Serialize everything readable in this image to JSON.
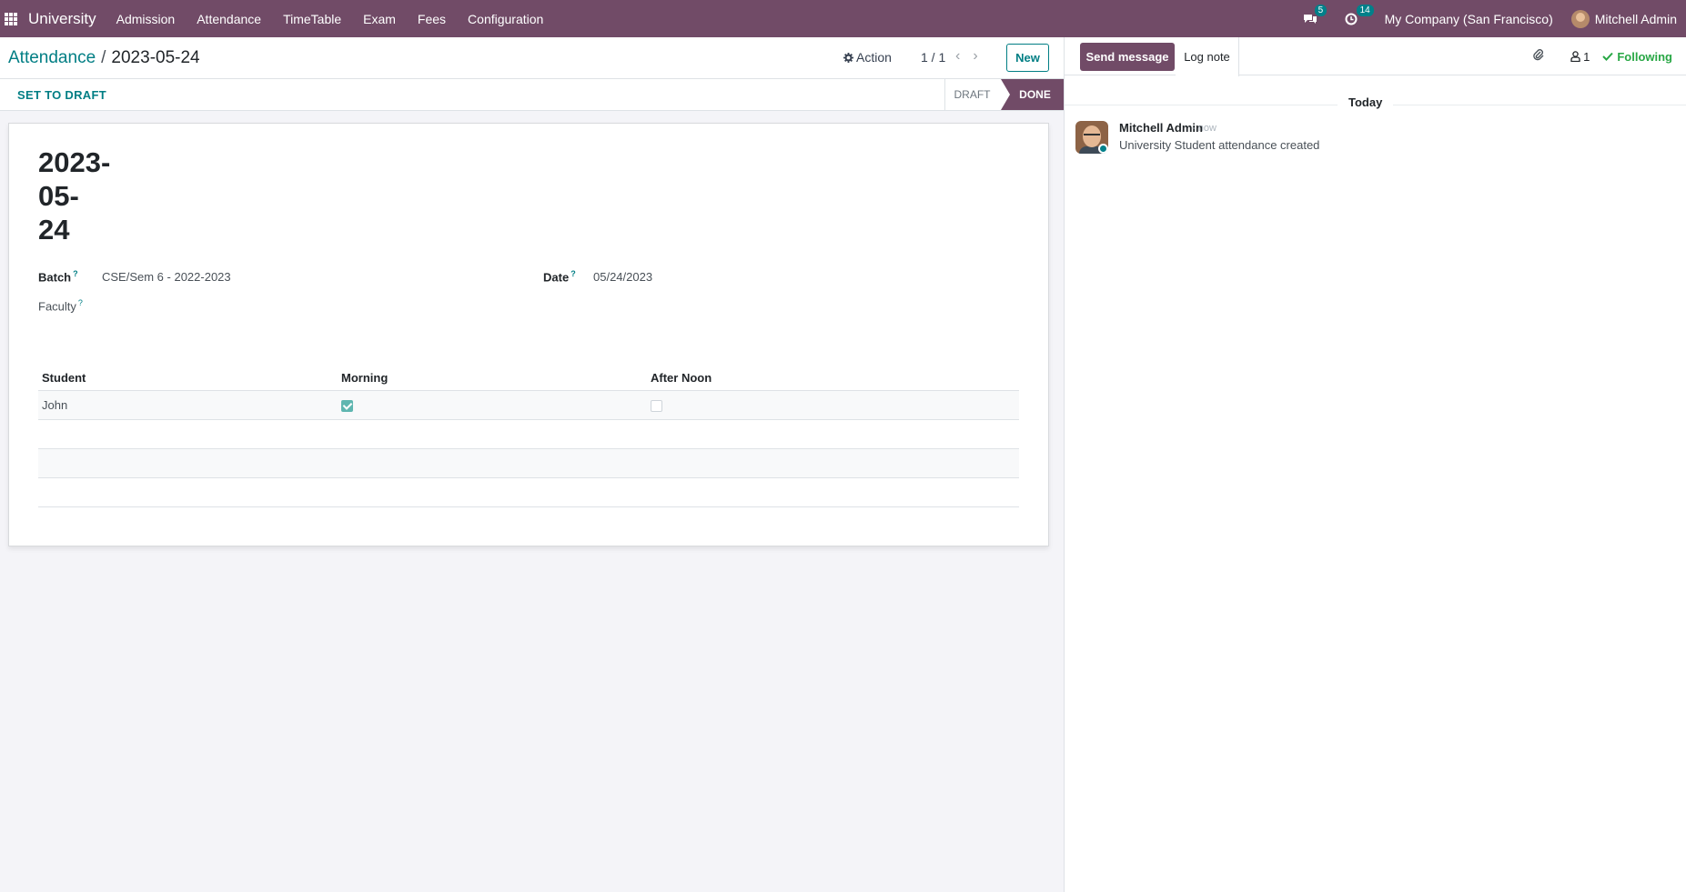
{
  "navbar": {
    "brand": "University",
    "menu": [
      "Admission",
      "Attendance",
      "TimeTable",
      "Exam",
      "Fees",
      "Configuration"
    ],
    "messages_count": "5",
    "activities_count": "14",
    "company": "My Company (San Francisco)",
    "user": "Mitchell Admin",
    "accent_color": "#714b67"
  },
  "control": {
    "breadcrumb_parent": "Attendance",
    "breadcrumb_sep": "/",
    "breadcrumb_current": "2023-05-24",
    "action_label": "Action",
    "pager": "1 / 1",
    "new_label": "New"
  },
  "status": {
    "set_to_draft_label": "SET TO DRAFT",
    "stages": [
      "DRAFT",
      "DONE"
    ],
    "current_stage": "DONE"
  },
  "form": {
    "title_lines": [
      "2023-",
      "05-",
      "24"
    ],
    "batch_label": "Batch",
    "batch_value": "CSE/Sem 6 - 2022-2023",
    "date_label": "Date",
    "date_value": "05/24/2023",
    "faculty_label": "Faculty",
    "help_mark": "?",
    "table": {
      "headers": [
        "Student",
        "Morning",
        "After Noon"
      ],
      "rows": [
        {
          "student": "John",
          "morning": true,
          "afternoon": false
        }
      ]
    }
  },
  "chatter": {
    "send_message_label": "Send message",
    "log_note_label": "Log note",
    "followers_count": "1",
    "following_label": "Following",
    "day_separator": "Today",
    "messages": [
      {
        "author": "Mitchell Admin",
        "time": "- now",
        "body": "University Student attendance created"
      }
    ]
  }
}
